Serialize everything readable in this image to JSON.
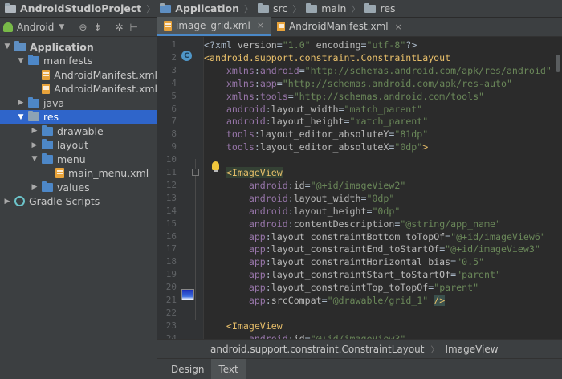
{
  "breadcrumb": [
    "AndroidStudioProject",
    "Application",
    "src",
    "main",
    "res"
  ],
  "project_panel": {
    "view": "Android",
    "tree": [
      {
        "label": "Application",
        "depth": 0,
        "arrow": "▼",
        "icon": "module-folder-icon",
        "bold": true
      },
      {
        "label": "manifests",
        "depth": 1,
        "arrow": "▼",
        "icon": "folder-icon"
      },
      {
        "label": "AndroidManifest.xml",
        "depth": 2,
        "arrow": "",
        "icon": "xml-file-icon"
      },
      {
        "label": "AndroidManifest.xml",
        "depth": 2,
        "arrow": "",
        "icon": "xml-file-icon"
      },
      {
        "label": "java",
        "depth": 1,
        "arrow": "▶",
        "icon": "folder-icon"
      },
      {
        "label": "res",
        "depth": 1,
        "arrow": "▼",
        "icon": "res-folder-icon",
        "selected": true
      },
      {
        "label": "drawable",
        "depth": 2,
        "arrow": "▶",
        "icon": "folder-icon"
      },
      {
        "label": "layout",
        "depth": 2,
        "arrow": "▶",
        "icon": "folder-icon"
      },
      {
        "label": "menu",
        "depth": 2,
        "arrow": "▼",
        "icon": "folder-icon"
      },
      {
        "label": "main_menu.xml",
        "depth": 3,
        "arrow": "",
        "icon": "xml-file-icon"
      },
      {
        "label": "values",
        "depth": 2,
        "arrow": "▶",
        "icon": "folder-icon"
      },
      {
        "label": "Gradle Scripts",
        "depth": 0,
        "arrow": "▶",
        "icon": "gradle-icon"
      }
    ]
  },
  "tabs": [
    {
      "label": "image_grid.xml",
      "active": true
    },
    {
      "label": "AndroidManifest.xml",
      "active": false
    }
  ],
  "editor": {
    "lines": [
      {
        "n": "1",
        "tokens": [
          [
            "t",
            "<?xml "
          ],
          [
            "a",
            "version"
          ],
          [
            "t",
            "="
          ],
          [
            "v",
            "\"1.0\""
          ],
          [
            "t",
            " "
          ],
          [
            "a",
            "encoding"
          ],
          [
            "t",
            "="
          ],
          [
            "v",
            "\"utf-8\""
          ],
          [
            "t",
            "?>"
          ]
        ]
      },
      {
        "n": "2",
        "tokens": [
          [
            "g",
            "<android.support.constraint.ConstraintLayout"
          ]
        ]
      },
      {
        "n": "3",
        "tokens": [
          [
            "t",
            "    "
          ],
          [
            "n",
            "xmlns"
          ],
          [
            "t",
            ":"
          ],
          [
            "n",
            "android"
          ],
          [
            "t",
            "="
          ],
          [
            "v",
            "\"http://schemas.android.com/apk/res/android\""
          ]
        ]
      },
      {
        "n": "4",
        "tokens": [
          [
            "t",
            "    "
          ],
          [
            "n",
            "xmlns"
          ],
          [
            "t",
            ":"
          ],
          [
            "n",
            "app"
          ],
          [
            "t",
            "="
          ],
          [
            "v",
            "\"http://schemas.android.com/apk/res-auto\""
          ]
        ]
      },
      {
        "n": "5",
        "tokens": [
          [
            "t",
            "    "
          ],
          [
            "n",
            "xmlns"
          ],
          [
            "t",
            ":"
          ],
          [
            "n",
            "tools"
          ],
          [
            "t",
            "="
          ],
          [
            "v",
            "\"http://schemas.android.com/tools\""
          ]
        ]
      },
      {
        "n": "6",
        "tokens": [
          [
            "t",
            "    "
          ],
          [
            "n",
            "android"
          ],
          [
            "t",
            ":"
          ],
          [
            "a",
            "layout_width"
          ],
          [
            "t",
            "="
          ],
          [
            "v",
            "\"match_parent\""
          ]
        ]
      },
      {
        "n": "7",
        "tokens": [
          [
            "t",
            "    "
          ],
          [
            "n",
            "android"
          ],
          [
            "t",
            ":"
          ],
          [
            "a",
            "layout_height"
          ],
          [
            "t",
            "="
          ],
          [
            "v",
            "\"match_parent\""
          ]
        ]
      },
      {
        "n": "8",
        "tokens": [
          [
            "t",
            "    "
          ],
          [
            "n",
            "tools"
          ],
          [
            "t",
            ":"
          ],
          [
            "a",
            "layout_editor_absoluteY"
          ],
          [
            "t",
            "="
          ],
          [
            "v",
            "\"81dp\""
          ]
        ]
      },
      {
        "n": "9",
        "tokens": [
          [
            "t",
            "    "
          ],
          [
            "n",
            "tools"
          ],
          [
            "t",
            ":"
          ],
          [
            "a",
            "layout_editor_absoluteX"
          ],
          [
            "t",
            "="
          ],
          [
            "v",
            "\"0dp\""
          ],
          [
            "g",
            ">"
          ]
        ]
      },
      {
        "n": "10",
        "tokens": []
      },
      {
        "n": "11",
        "tokens": [
          [
            "t",
            "    "
          ],
          [
            "h",
            "<ImageView"
          ]
        ]
      },
      {
        "n": "12",
        "tokens": [
          [
            "t",
            "        "
          ],
          [
            "n",
            "android"
          ],
          [
            "t",
            ":"
          ],
          [
            "a",
            "id"
          ],
          [
            "t",
            "="
          ],
          [
            "v",
            "\"@+id/imageView2\""
          ]
        ]
      },
      {
        "n": "13",
        "tokens": [
          [
            "t",
            "        "
          ],
          [
            "n",
            "android"
          ],
          [
            "t",
            ":"
          ],
          [
            "a",
            "layout_width"
          ],
          [
            "t",
            "="
          ],
          [
            "v",
            "\"0dp\""
          ]
        ]
      },
      {
        "n": "14",
        "tokens": [
          [
            "t",
            "        "
          ],
          [
            "n",
            "android"
          ],
          [
            "t",
            ":"
          ],
          [
            "a",
            "layout_height"
          ],
          [
            "t",
            "="
          ],
          [
            "v",
            "\"0dp\""
          ]
        ]
      },
      {
        "n": "15",
        "tokens": [
          [
            "t",
            "        "
          ],
          [
            "n",
            "android"
          ],
          [
            "t",
            ":"
          ],
          [
            "a",
            "contentDescription"
          ],
          [
            "t",
            "="
          ],
          [
            "v",
            "\"@string/app_name\""
          ]
        ]
      },
      {
        "n": "16",
        "tokens": [
          [
            "t",
            "        "
          ],
          [
            "n",
            "app"
          ],
          [
            "t",
            ":"
          ],
          [
            "a",
            "layout_constraintBottom_toTopOf"
          ],
          [
            "t",
            "="
          ],
          [
            "v",
            "\"@+id/imageView6\""
          ]
        ]
      },
      {
        "n": "17",
        "tokens": [
          [
            "t",
            "        "
          ],
          [
            "n",
            "app"
          ],
          [
            "t",
            ":"
          ],
          [
            "a",
            "layout_constraintEnd_toStartOf"
          ],
          [
            "t",
            "="
          ],
          [
            "v",
            "\"@+id/imageView3\""
          ]
        ]
      },
      {
        "n": "18",
        "tokens": [
          [
            "t",
            "        "
          ],
          [
            "n",
            "app"
          ],
          [
            "t",
            ":"
          ],
          [
            "a",
            "layout_constraintHorizontal_bias"
          ],
          [
            "t",
            "="
          ],
          [
            "v",
            "\"0.5\""
          ]
        ]
      },
      {
        "n": "19",
        "tokens": [
          [
            "t",
            "        "
          ],
          [
            "n",
            "app"
          ],
          [
            "t",
            ":"
          ],
          [
            "a",
            "layout_constraintStart_toStartOf"
          ],
          [
            "t",
            "="
          ],
          [
            "v",
            "\"parent\""
          ]
        ]
      },
      {
        "n": "20",
        "tokens": [
          [
            "t",
            "        "
          ],
          [
            "n",
            "app"
          ],
          [
            "t",
            ":"
          ],
          [
            "a",
            "layout_constraintTop_toTopOf"
          ],
          [
            "t",
            "="
          ],
          [
            "v",
            "\"parent\""
          ]
        ]
      },
      {
        "n": "21",
        "tokens": [
          [
            "t",
            "        "
          ],
          [
            "n",
            "app"
          ],
          [
            "t",
            ":"
          ],
          [
            "a",
            "srcCompat"
          ],
          [
            "t",
            "="
          ],
          [
            "v",
            "\"@drawable/grid_1\""
          ],
          [
            "t",
            " "
          ],
          [
            "e",
            "/>"
          ]
        ]
      },
      {
        "n": "22",
        "tokens": []
      },
      {
        "n": "23",
        "tokens": [
          [
            "t",
            "    "
          ],
          [
            "g",
            "<ImageView"
          ]
        ]
      },
      {
        "n": "24",
        "tokens": [
          [
            "t",
            "        "
          ],
          [
            "n",
            "android"
          ],
          [
            "t",
            ":"
          ],
          [
            "a",
            "id"
          ],
          [
            "t",
            "="
          ],
          [
            "v",
            "\"@+id/imageView3\""
          ]
        ]
      }
    ]
  },
  "path_bar": [
    "android.support.constraint.ConstraintLayout",
    "ImageView"
  ],
  "design_tabs": [
    {
      "label": "Design",
      "active": false
    },
    {
      "label": "Text",
      "active": true
    }
  ],
  "colors": {
    "tag": "#e8bf6a",
    "attribute": "#bababa",
    "namespace": "#9876aa",
    "value": "#6a8759",
    "selection": "#2f65ca"
  }
}
